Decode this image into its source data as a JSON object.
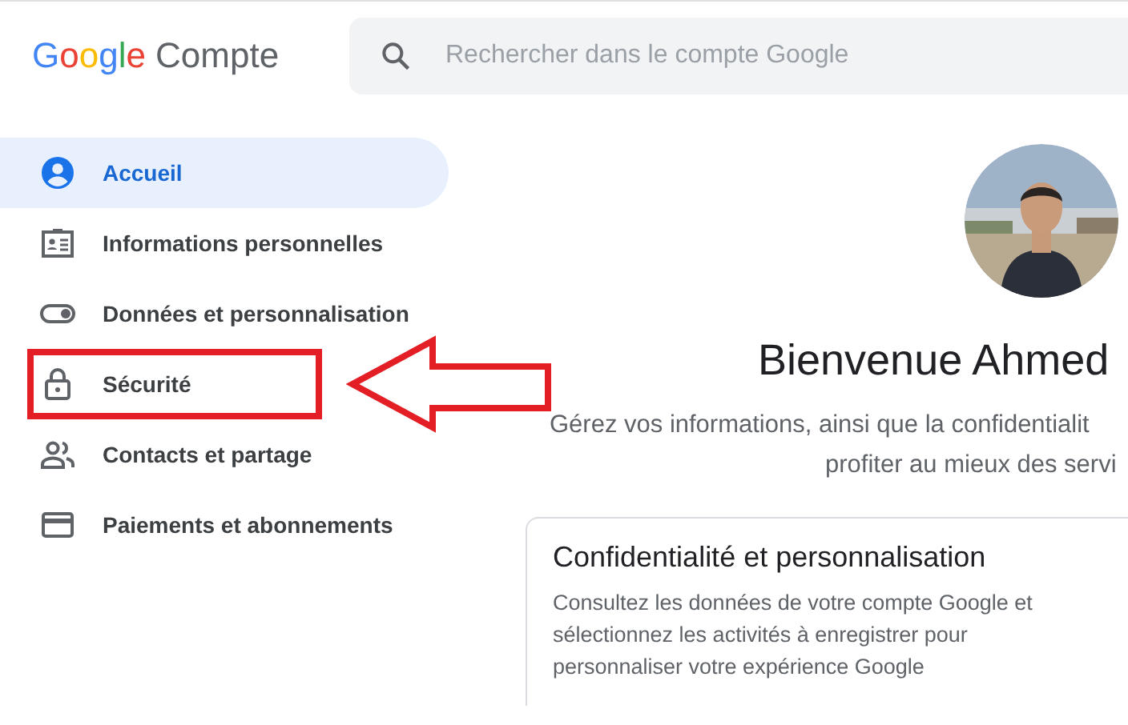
{
  "header": {
    "logo": "Google",
    "product": "Compte",
    "search": {
      "placeholder": "Rechercher dans le compte Google"
    }
  },
  "sidebar": {
    "items": [
      {
        "label": "Accueil",
        "kind": "home",
        "selected": true,
        "annotated": false
      },
      {
        "label": "Informations personnelles",
        "kind": "id",
        "selected": false,
        "annotated": false
      },
      {
        "label": "Données et personnalisation",
        "kind": "toggle",
        "selected": false,
        "annotated": false
      },
      {
        "label": "Sécurité",
        "kind": "lock",
        "selected": false,
        "annotated": true
      },
      {
        "label": "Contacts et partage",
        "kind": "people",
        "selected": false,
        "annotated": false
      },
      {
        "label": "Paiements et abonnements",
        "kind": "card",
        "selected": false,
        "annotated": false
      }
    ]
  },
  "main": {
    "title": "Bienvenue Ahmed",
    "subtitle_lines": [
      "Gérez vos informations, ainsi que la confidentialit",
      "profiter au mieux des servi"
    ],
    "card": {
      "title": "Confidentialité et personnalisation",
      "body": "Consultez les données de votre compte Google et sélectionnez les activités à enregistrer pour personnaliser votre expérience Google"
    }
  }
}
